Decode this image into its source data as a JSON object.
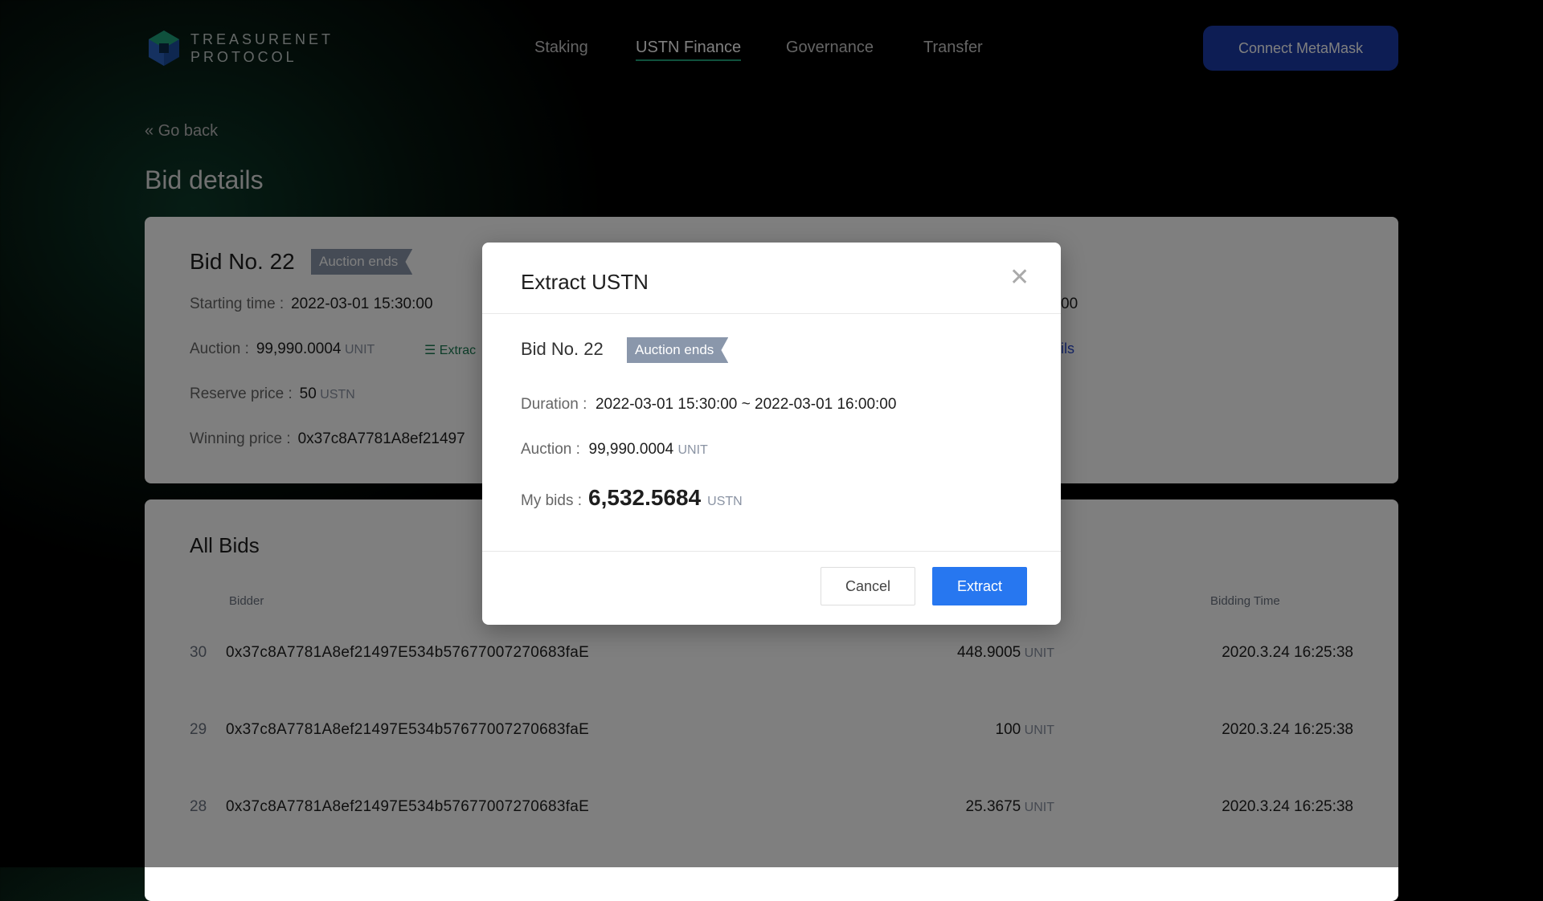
{
  "header": {
    "logo_line1": "TREASURENET",
    "logo_line2": "PROTOCOL",
    "nav": [
      "Staking",
      "USTN Finance",
      "Governance",
      "Transfer"
    ],
    "active_nav": "USTN Finance",
    "connect_label": "Connect MetaMask"
  },
  "page": {
    "go_back": "Go back",
    "title": "Bid details"
  },
  "bid_card": {
    "title": "Bid No. 22",
    "badge": "Auction ends",
    "starting_label": "Starting time :",
    "starting_value": "2022-03-01 15:30:00",
    "auction_label": "Auction :",
    "auction_value": "99,990.0004",
    "auction_unit": "UNIT",
    "extract_fragment": "Extrac",
    "reserve_label": "Reserve price :",
    "reserve_value": "50",
    "reserve_unit": "USTN",
    "winning_label": "Winning price :",
    "winning_value": "0x37c8A7781A8ef21497",
    "right_fragment_1": "00",
    "right_fragment_2": "ils"
  },
  "all_bids": {
    "title": "All Bids",
    "col_bidder": "Bidder",
    "col_time": "Bidding Time",
    "rows": [
      {
        "index": "30",
        "bidder": "0x37c8A7781A8ef21497E534b57677007270683faE",
        "amount": "448.9005",
        "unit": "UNIT",
        "time": "2020.3.24 16:25:38"
      },
      {
        "index": "29",
        "bidder": "0x37c8A7781A8ef21497E534b57677007270683faE",
        "amount": "100",
        "unit": "UNIT",
        "time": "2020.3.24 16:25:38"
      },
      {
        "index": "28",
        "bidder": "0x37c8A7781A8ef21497E534b57677007270683faE",
        "amount": "25.3675",
        "unit": "UNIT",
        "time": "2020.3.24 16:25:38"
      }
    ]
  },
  "modal": {
    "title": "Extract USTN",
    "bid_title": "Bid No. 22",
    "badge": "Auction ends",
    "duration_label": "Duration :",
    "duration_value": "2022-03-01 15:30:00 ~ 2022-03-01 16:00:00",
    "auction_label": "Auction :",
    "auction_value": "99,990.0004",
    "auction_unit": "UNIT",
    "mybids_label": "My bids :",
    "mybids_value": "6,532.5684",
    "mybids_unit": "USTN",
    "cancel_label": "Cancel",
    "extract_label": "Extract"
  },
  "colors": {
    "accent": "#2777f0",
    "nav_underline": "#1fa27a",
    "connect": "#1a3aa8",
    "badge": "#8a97ab"
  }
}
